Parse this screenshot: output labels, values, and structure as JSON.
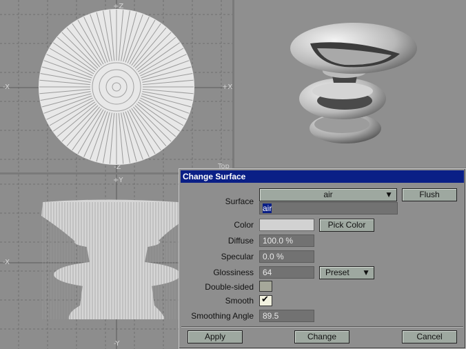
{
  "viewports": {
    "top": {
      "axis_plus_z": "+Z",
      "axis_minus_z": "-Z",
      "axis_minus_x": "-X",
      "axis_plus_x": "+X",
      "name": "Top"
    },
    "front": {
      "axis_plus_y": "+Y",
      "axis_minus_y": "-Y",
      "axis_minus_x": "-X"
    }
  },
  "dialog": {
    "title": "Change Surface",
    "surface_label": "Surface",
    "surface_select": "air",
    "surface_name": "air",
    "flush_label": "Flush",
    "color_label": "Color",
    "pick_color_label": "Pick Color",
    "diffuse_label": "Diffuse",
    "diffuse_value": "100.0 %",
    "specular_label": "Specular",
    "specular_value": "0.0 %",
    "glossiness_label": "Glossiness",
    "glossiness_value": "64",
    "preset_label": "Preset",
    "double_sided_label": "Double-sided",
    "double_sided_checked": false,
    "smooth_label": "Smooth",
    "smooth_checked": true,
    "smoothing_angle_label": "Smoothing Angle",
    "smoothing_angle_value": "89.5",
    "apply_label": "Apply",
    "change_label": "Change",
    "cancel_label": "Cancel",
    "colors": {
      "title_bar": "#0a1f86",
      "swatch": "#d2d2d2",
      "button": "#9ea8a0"
    }
  }
}
